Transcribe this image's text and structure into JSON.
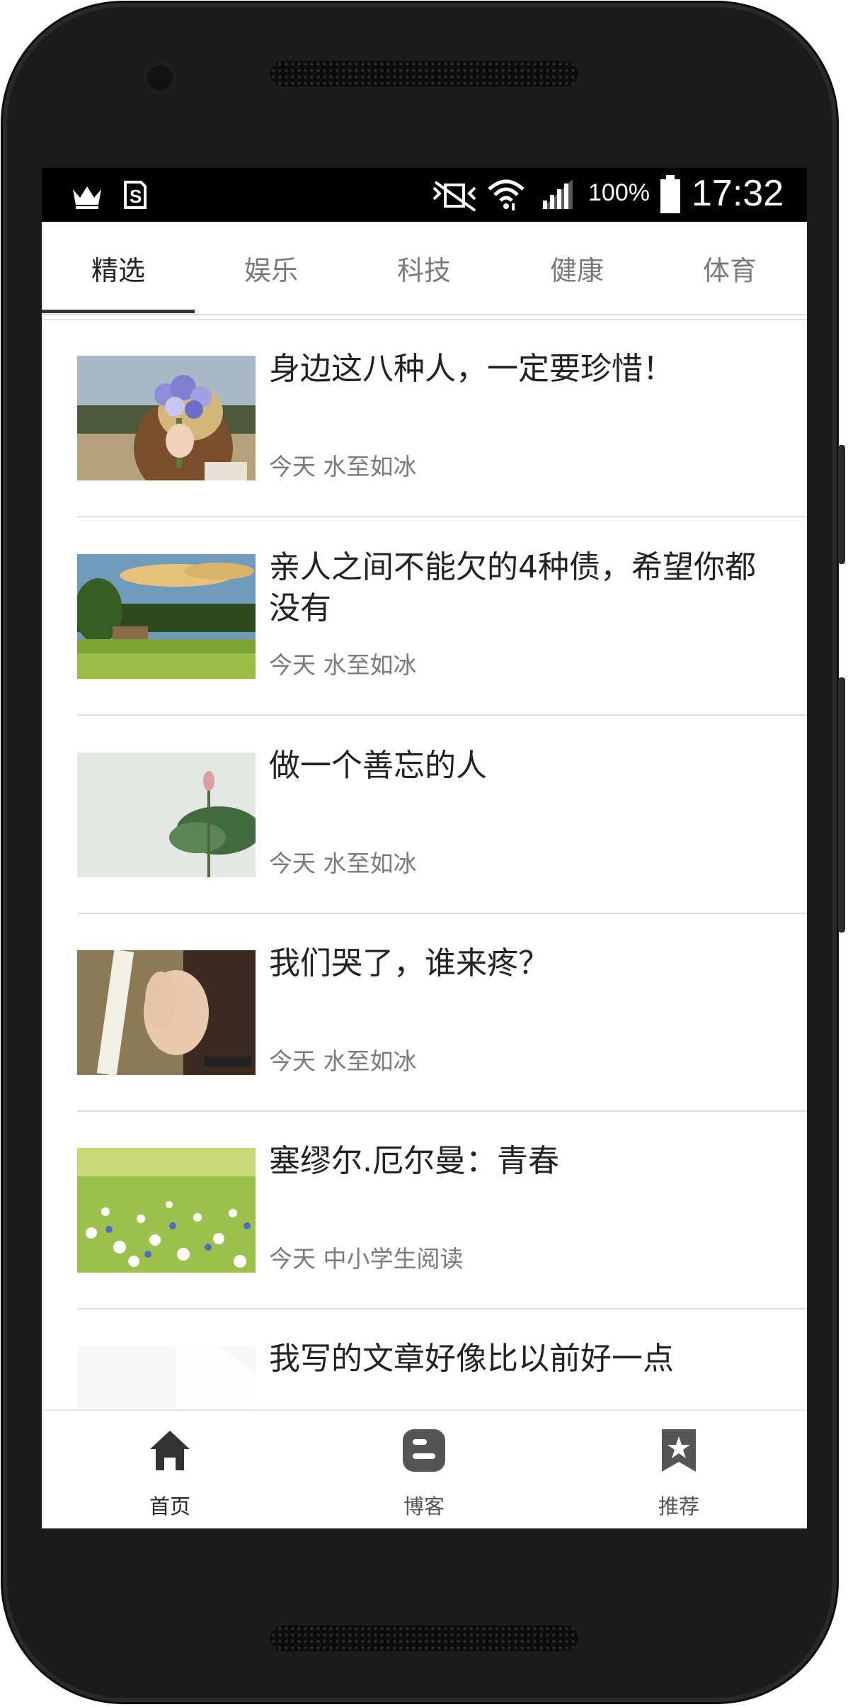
{
  "status_bar": {
    "battery_percent": "100%",
    "time": "17:32",
    "icons": [
      "crown-icon",
      "s-app-icon",
      "vibrate-mute-icon",
      "wifi-icon",
      "signal-icon",
      "battery-icon"
    ]
  },
  "tabs": [
    {
      "label": "精选",
      "active": true
    },
    {
      "label": "娱乐",
      "active": false
    },
    {
      "label": "科技",
      "active": false
    },
    {
      "label": "健康",
      "active": false
    },
    {
      "label": "体育",
      "active": false
    }
  ],
  "articles": [
    {
      "title": "身边这八种人，一定要珍惜！",
      "meta": "今天 水至如冰",
      "thumb": "woman-flowers"
    },
    {
      "title": "亲人之间不能欠的4种债，希望你都没有",
      "meta": "今天 水至如冰",
      "thumb": "countryside-landscape"
    },
    {
      "title": "做一个善忘的人",
      "meta": "今天 水至如冰",
      "thumb": "lotus-leaf"
    },
    {
      "title": "我们哭了，谁来疼？",
      "meta": "今天 水至如冰",
      "thumb": "girl-portrait"
    },
    {
      "title": "塞缪尔.厄尔曼：青春",
      "meta": "今天 中小学生阅读",
      "thumb": "flower-meadow"
    },
    {
      "title": "我写的文章好像比以前好一点",
      "meta": "",
      "thumb": "blank"
    }
  ],
  "bottom_nav": [
    {
      "label": "首页",
      "icon": "home-icon",
      "active": true
    },
    {
      "label": "博客",
      "icon": "blogger-icon",
      "active": false
    },
    {
      "label": "推荐",
      "icon": "bookmark-star-icon",
      "active": false
    }
  ],
  "colors": {
    "status_bar_bg": "#000000",
    "active_text": "#222222",
    "inactive_text": "#7a7a7a",
    "divider": "#dcdcdc",
    "phone_body": "#1b1b1b"
  }
}
